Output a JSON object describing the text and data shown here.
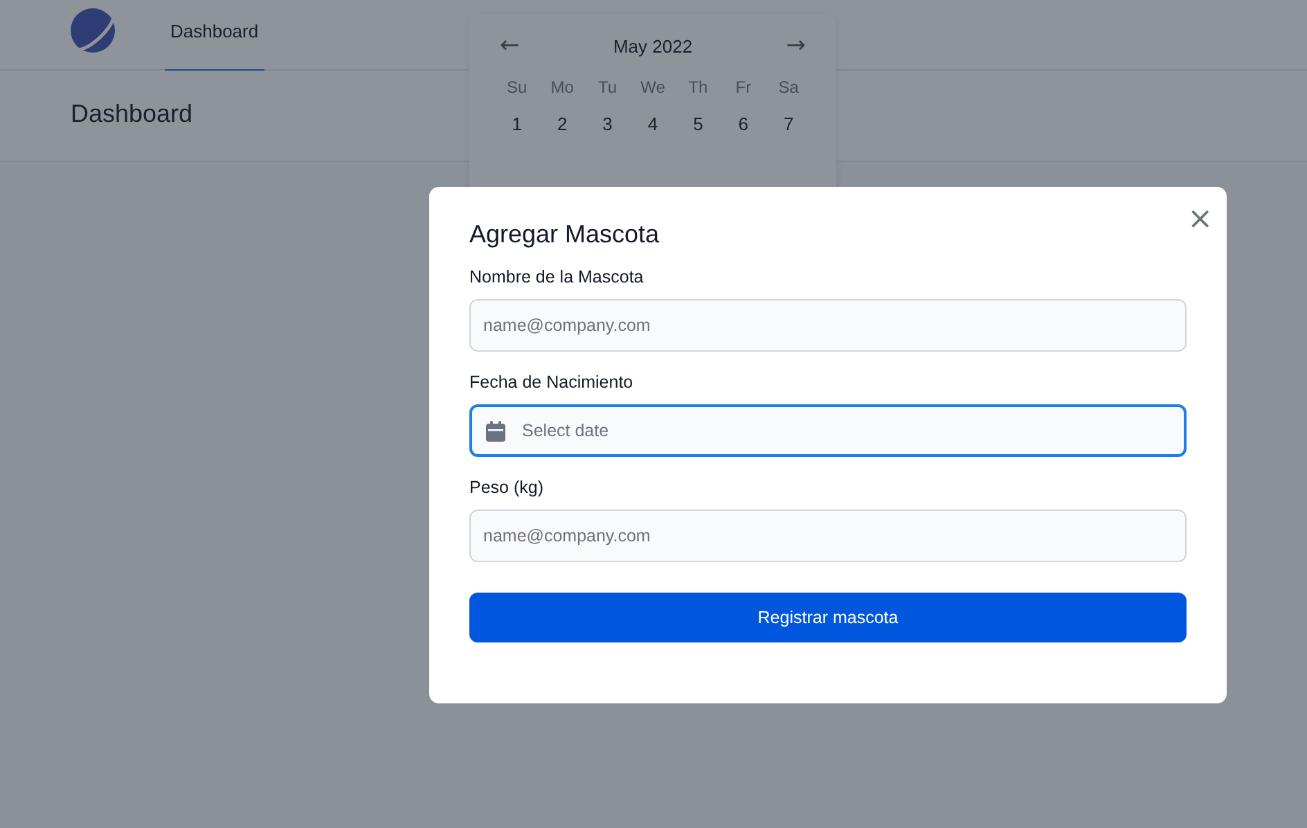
{
  "nav": {
    "tabs": [
      {
        "label": "Dashboard",
        "selected": true
      }
    ]
  },
  "page": {
    "title": "Dashboard"
  },
  "calendar": {
    "month": "May 2022",
    "prev": "←",
    "next": "→",
    "weekdays": [
      "Su",
      "Mo",
      "Tu",
      "We",
      "Th",
      "Fr",
      "Sa"
    ],
    "days": [
      "1",
      "2",
      "3",
      "4",
      "5",
      "6",
      "7"
    ]
  },
  "modal": {
    "title": "Agregar Mascota",
    "close": "×",
    "fields": [
      {
        "kind": "text",
        "label": "Nombre de la Mascota",
        "placeholder": "name@company.com",
        "focused": false
      },
      {
        "kind": "date",
        "label": "Fecha de Nacimiento",
        "placeholder": "Select date",
        "focused": true
      },
      {
        "kind": "text",
        "label": "Peso (kg)",
        "placeholder": "name@company.com",
        "focused": false
      }
    ],
    "submit": "Registrar mascota"
  }
}
